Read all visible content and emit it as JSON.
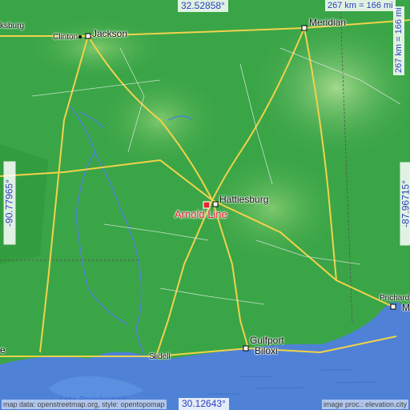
{
  "coordinates": {
    "top": "32.52858°",
    "bottom": "30.12643°",
    "left": "-90.77965°",
    "right": "-87.96715°"
  },
  "scale": {
    "horizontal": "267 km = 166 mi",
    "vertical": "267 km = 166 mi"
  },
  "cities": [
    {
      "name": "Jackson"
    },
    {
      "name": "Clinton"
    },
    {
      "name": "ksburg"
    },
    {
      "name": "Meridian"
    },
    {
      "name": "Hattiesburg"
    },
    {
      "name": "Gulfport"
    },
    {
      "name": "Biloxi"
    },
    {
      "name": "Slidell"
    },
    {
      "name": "Prichard"
    },
    {
      "name": "M"
    },
    {
      "name": "e"
    }
  ],
  "focus_location": "Arnold Line",
  "water_labels": [
    "Lake Pontchartrain"
  ],
  "credits": {
    "left": "map data: openstreetmap.org, style: opentopomap",
    "right": "image proc.: elevation.city"
  },
  "colors": {
    "land": "#3aa547",
    "highland": "#8ccf7a",
    "water": "#4f82d6",
    "road": "#f1d24a",
    "focus": "#e8262b",
    "coord_text": "#2b3fbf"
  }
}
